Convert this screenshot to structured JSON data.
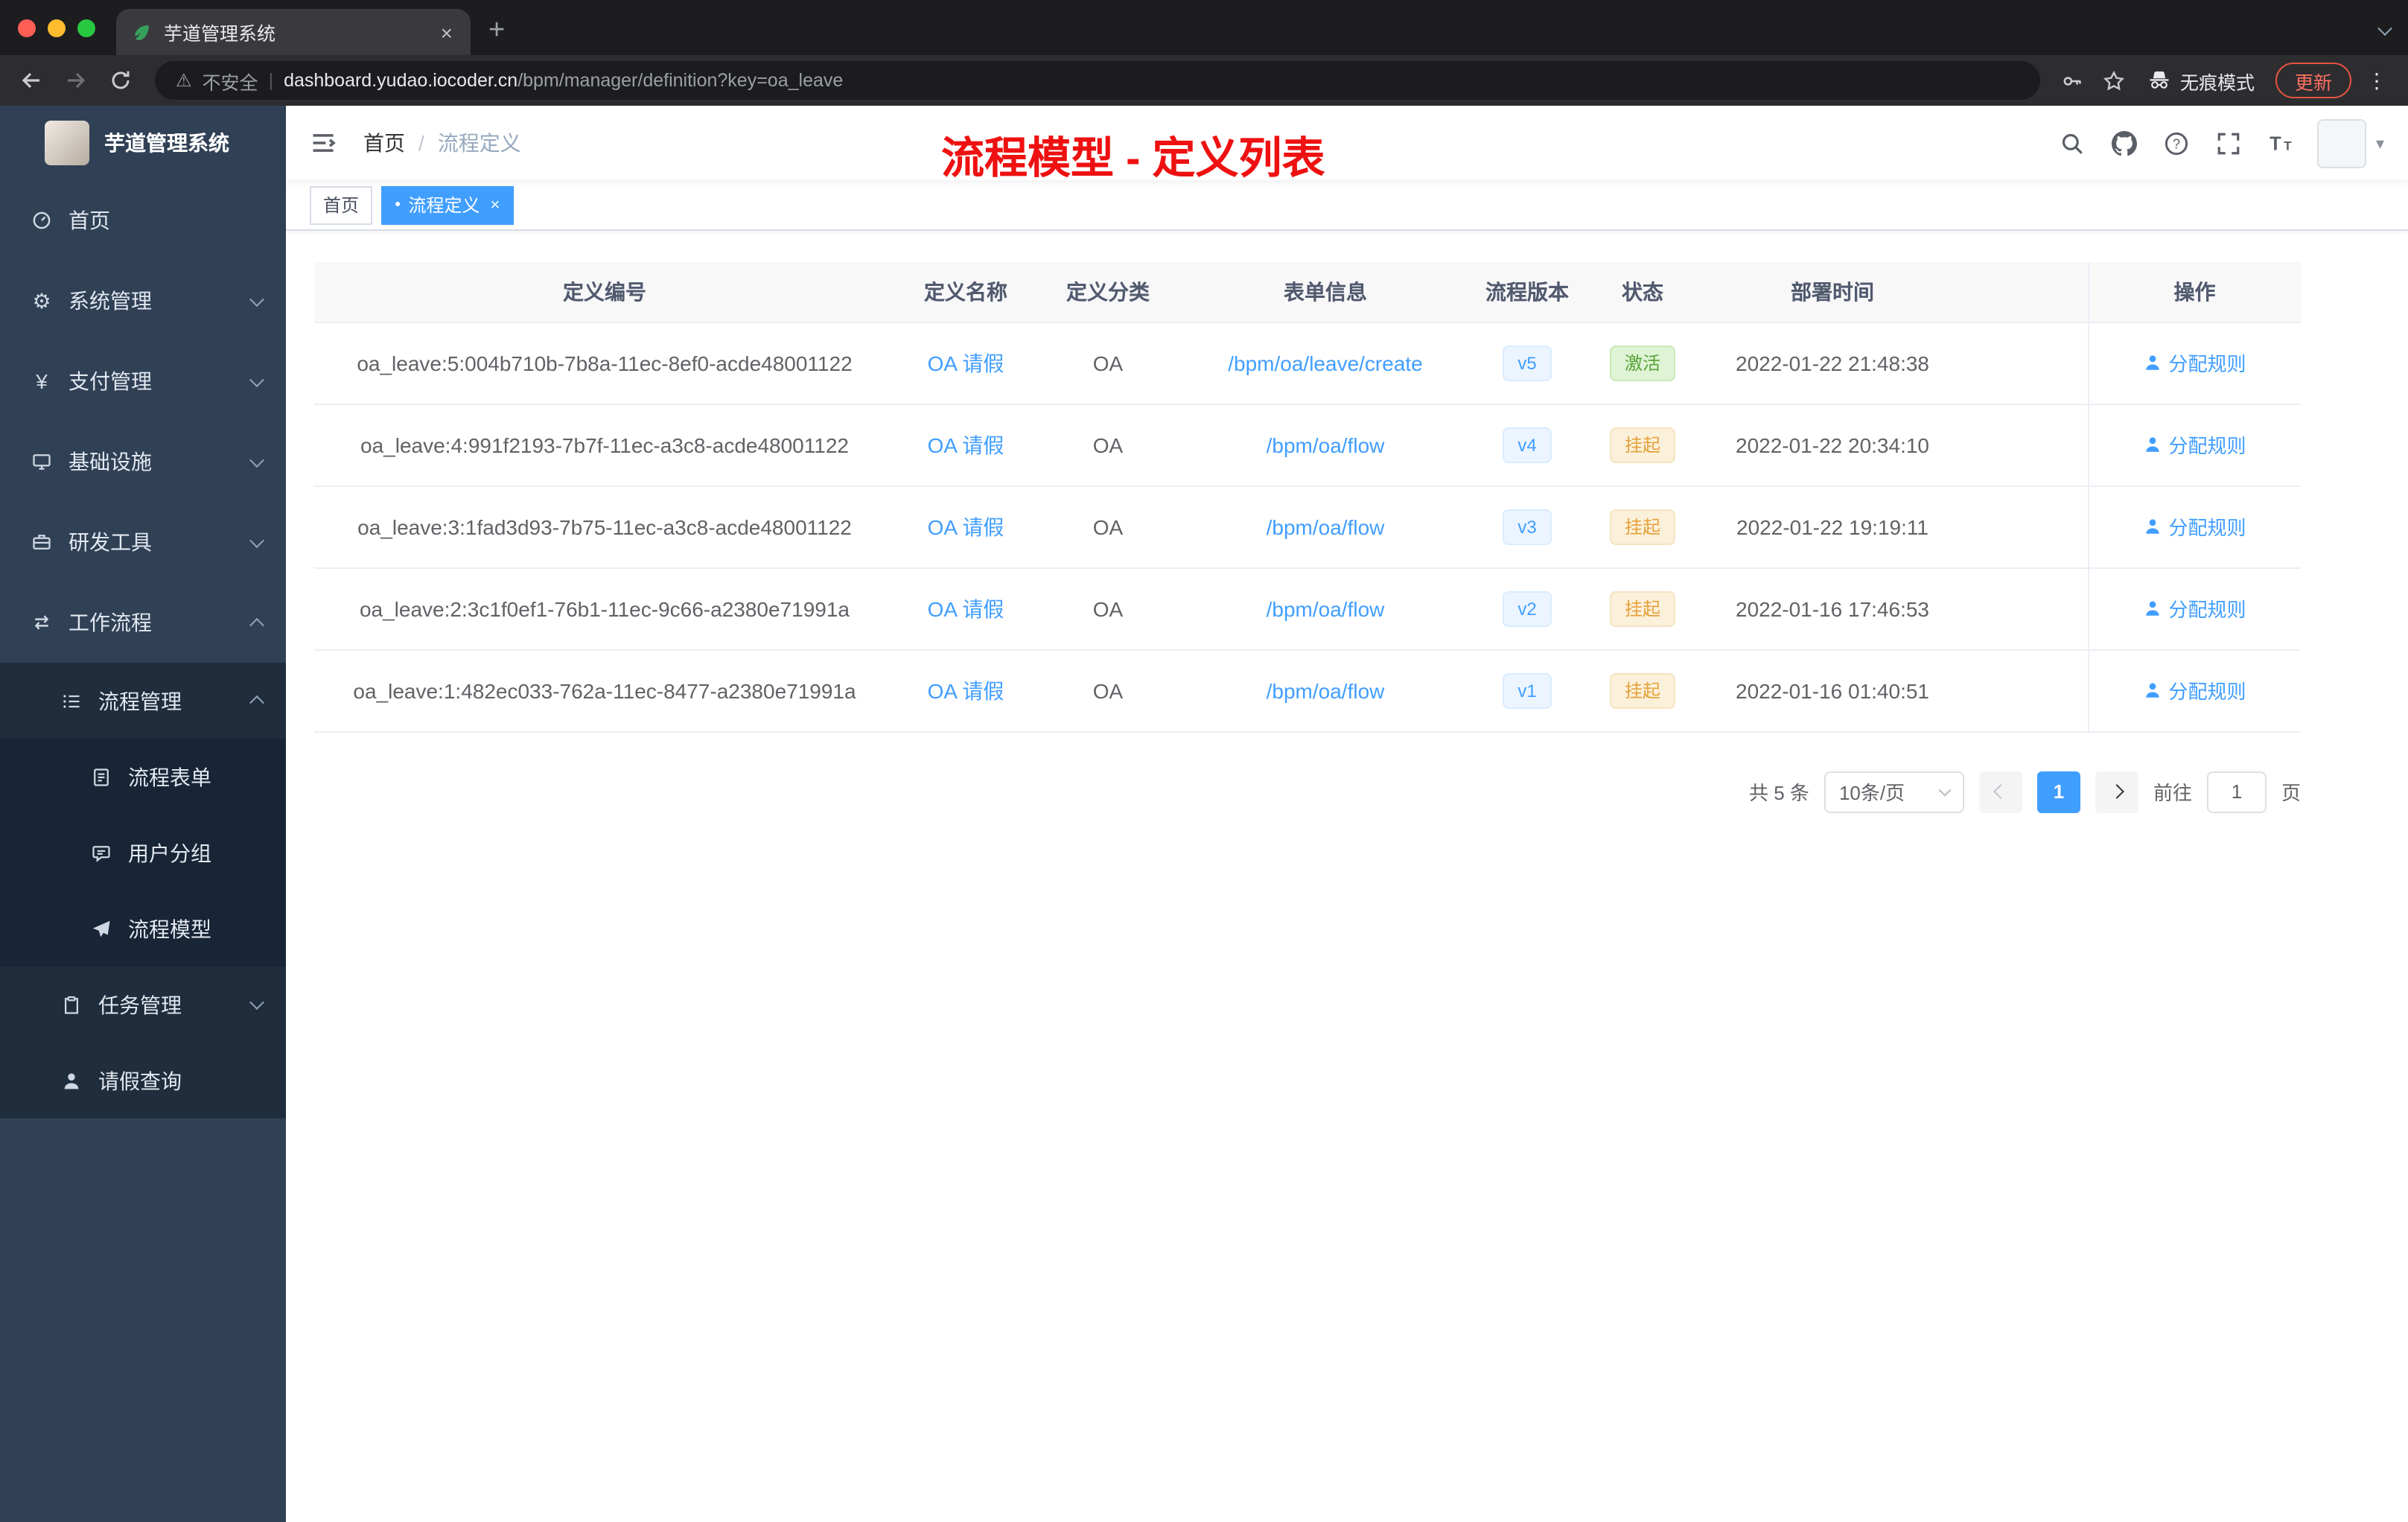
{
  "colors": {
    "accent": "#409eff",
    "annotation_red": "#ee1111",
    "status_success": "#58a435",
    "status_warning": "#e6a23c",
    "sidebar_bg": "#304156",
    "submenu_bg": "#1f2d3d"
  },
  "icons": {
    "close": "×",
    "plus": "+",
    "kebab": "⋮",
    "gear": "⚙",
    "yen": "¥",
    "warning": "⚠",
    "divider": "|",
    "slash": "/",
    "caret": "▾",
    "dot": "●"
  },
  "browser": {
    "tab_title": "芋道管理系统",
    "security_label": "不安全",
    "url_host": "dashboard.yudao.iocoder.cn",
    "url_path": "/bpm/manager/definition?key=oa_leave",
    "incognito_label": "无痕模式",
    "update_label": "更新"
  },
  "sidebar": {
    "logo_title": "芋道管理系统",
    "items": [
      {
        "label": "首页"
      },
      {
        "label": "系统管理"
      },
      {
        "label": "支付管理"
      },
      {
        "label": "基础设施"
      },
      {
        "label": "研发工具"
      },
      {
        "label": "工作流程"
      },
      {
        "label": "流程管理"
      },
      {
        "label": "流程表单"
      },
      {
        "label": "用户分组"
      },
      {
        "label": "流程模型"
      },
      {
        "label": "任务管理"
      },
      {
        "label": "请假查询"
      }
    ]
  },
  "navbar": {
    "breadcrumb_home": "首页",
    "breadcrumb_current": "流程定义",
    "annotation": "流程模型 - 定义列表"
  },
  "tags": {
    "home": "首页",
    "active": "流程定义"
  },
  "table": {
    "headers": [
      "定义编号",
      "定义名称",
      "定义分类",
      "表单信息",
      "流程版本",
      "状态",
      "部署时间",
      "操作"
    ],
    "action_label": "分配规则",
    "rows": [
      {
        "id": "oa_leave:5:004b710b-7b8a-11ec-8ef0-acde48001122",
        "name": "OA 请假",
        "category": "OA",
        "form": "/bpm/oa/leave/create",
        "version": "v5",
        "status": "激活",
        "status_type": "success",
        "deploy_time": "2022-01-22 21:48:38"
      },
      {
        "id": "oa_leave:4:991f2193-7b7f-11ec-a3c8-acde48001122",
        "name": "OA 请假",
        "category": "OA",
        "form": "/bpm/oa/flow",
        "version": "v4",
        "status": "挂起",
        "status_type": "warning",
        "deploy_time": "2022-01-22 20:34:10"
      },
      {
        "id": "oa_leave:3:1fad3d93-7b75-11ec-a3c8-acde48001122",
        "name": "OA 请假",
        "category": "OA",
        "form": "/bpm/oa/flow",
        "version": "v3",
        "status": "挂起",
        "status_type": "warning",
        "deploy_time": "2022-01-22 19:19:11"
      },
      {
        "id": "oa_leave:2:3c1f0ef1-76b1-11ec-9c66-a2380e71991a",
        "name": "OA 请假",
        "category": "OA",
        "form": "/bpm/oa/flow",
        "version": "v2",
        "status": "挂起",
        "status_type": "warning",
        "deploy_time": "2022-01-16 17:46:53"
      },
      {
        "id": "oa_leave:1:482ec033-762a-11ec-8477-a2380e71991a",
        "name": "OA 请假",
        "category": "OA",
        "form": "/bpm/oa/flow",
        "version": "v1",
        "status": "挂起",
        "status_type": "warning",
        "deploy_time": "2022-01-16 01:40:51"
      }
    ]
  },
  "pagination": {
    "total": "共 5 条",
    "page_size": "10条/页",
    "current_page": "1",
    "goto_label": "前往",
    "goto_value": "1",
    "unit_label": "页"
  }
}
